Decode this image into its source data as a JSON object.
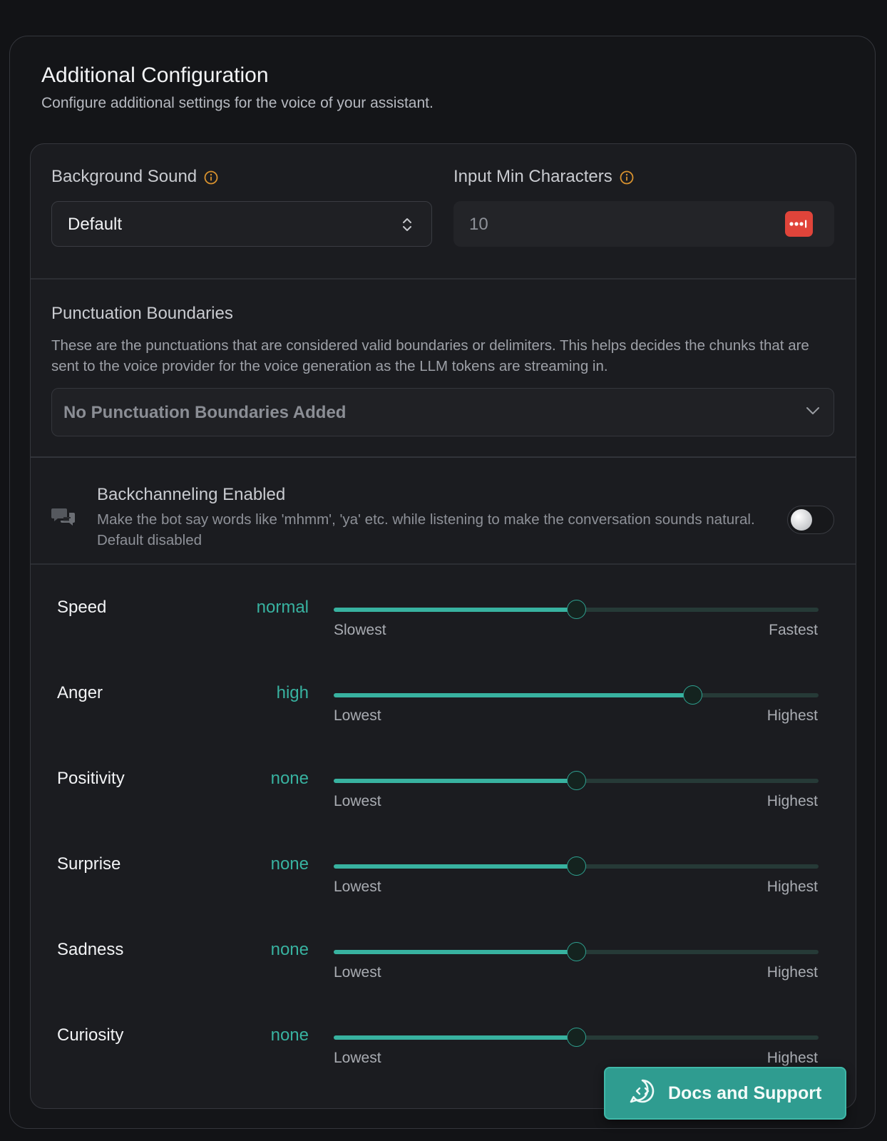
{
  "header": {
    "title": "Additional Configuration",
    "subtitle": "Configure additional settings for the voice of your assistant."
  },
  "background_sound": {
    "label": "Background Sound",
    "value": "Default"
  },
  "input_min_characters": {
    "label": "Input Min Characters",
    "value": "10"
  },
  "punctuation": {
    "title": "Punctuation Boundaries",
    "description": "These are the punctuations that are considered valid boundaries or delimiters. This helps decides the chunks that are sent to the voice provider for the voice generation as the LLM tokens are streaming in.",
    "placeholder": "No Punctuation Boundaries Added"
  },
  "backchanneling": {
    "title": "Backchanneling Enabled",
    "description": "Make the bot say words like 'mhmm', 'ya' etc. while listening to make the conversation sounds natural. Default disabled",
    "enabled": false
  },
  "sliders": [
    {
      "label": "Speed",
      "value": "normal",
      "level": 0.5,
      "min_label": "Slowest",
      "max_label": "Fastest"
    },
    {
      "label": "Anger",
      "value": "high",
      "level": 0.74,
      "min_label": "Lowest",
      "max_label": "Highest"
    },
    {
      "label": "Positivity",
      "value": "none",
      "level": 0.5,
      "min_label": "Lowest",
      "max_label": "Highest"
    },
    {
      "label": "Surprise",
      "value": "none",
      "level": 0.5,
      "min_label": "Lowest",
      "max_label": "Highest"
    },
    {
      "label": "Sadness",
      "value": "none",
      "level": 0.5,
      "min_label": "Lowest",
      "max_label": "Highest"
    },
    {
      "label": "Curiosity",
      "value": "none",
      "level": 0.5,
      "min_label": "Lowest",
      "max_label": "Highest"
    }
  ],
  "docs_button": {
    "label": "Docs and Support"
  },
  "colors": {
    "accent": "#38b2a0",
    "warning_icon": "#d9922e",
    "badge": "#e0443a"
  }
}
